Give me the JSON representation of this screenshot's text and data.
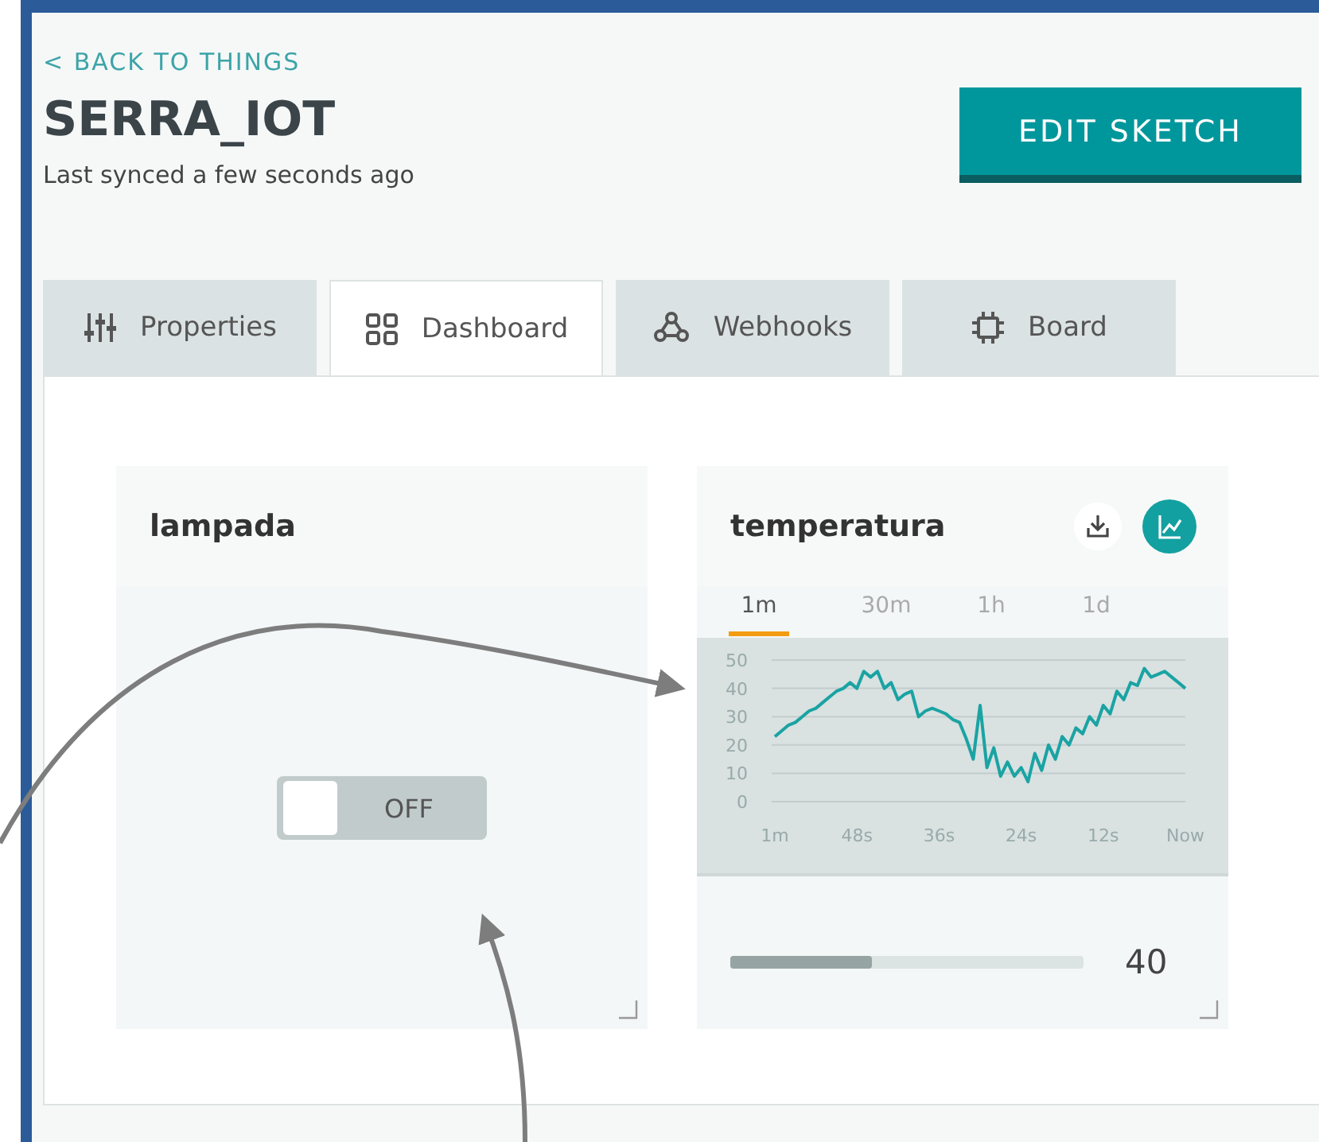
{
  "back_link": "< BACK TO THINGS",
  "title": "SERRA_IOT",
  "sync_status": "Last synced a few seconds ago",
  "edit_button": "EDIT SKETCH",
  "tabs": [
    {
      "label": "Properties",
      "kind": "sliders",
      "selected": false
    },
    {
      "label": "Dashboard",
      "kind": "grid",
      "selected": true
    },
    {
      "label": "Webhooks",
      "kind": "webhook",
      "selected": false
    },
    {
      "label": "Board",
      "kind": "chip",
      "selected": false
    }
  ],
  "widgets": [
    {
      "kind": "switch",
      "title": "lampada",
      "on": false,
      "state_label": "OFF"
    },
    {
      "kind": "chart",
      "title": "temperatura",
      "ranges": [
        {
          "label": "1m",
          "selected": true
        },
        {
          "label": "30m",
          "selected": false
        },
        {
          "label": "1h",
          "selected": false
        },
        {
          "label": "1d",
          "selected": false
        }
      ],
      "chart_data": {
        "type": "line",
        "grid": true,
        "categories": [
          "1m",
          null,
          null,
          null,
          null,
          null,
          null,
          null,
          null,
          null,
          null,
          null,
          "48s",
          null,
          null,
          null,
          null,
          null,
          null,
          null,
          null,
          null,
          null,
          null,
          "36s",
          null,
          null,
          null,
          null,
          null,
          null,
          null,
          null,
          null,
          null,
          null,
          "24s",
          null,
          null,
          null,
          null,
          null,
          null,
          null,
          null,
          null,
          null,
          null,
          "12s",
          null,
          null,
          null,
          null,
          null,
          null,
          null,
          null,
          null,
          null,
          null,
          "Now"
        ],
        "series": [
          {
            "color": "#1aa3a3",
            "values": [
              23,
              25,
              27,
              28,
              30,
              32,
              33,
              35,
              37,
              39,
              40,
              42,
              40,
              46,
              44,
              46,
              40,
              42,
              36,
              38,
              39,
              30,
              32,
              33,
              32,
              31,
              29,
              28,
              22,
              15,
              34,
              12,
              19,
              9,
              14,
              9,
              12,
              7,
              17,
              11,
              20,
              15,
              23,
              20,
              26,
              24,
              30,
              27,
              34,
              31,
              39,
              36,
              42,
              41,
              47,
              44,
              45,
              46,
              44,
              42,
              40
            ]
          }
        ],
        "ylim": [
          0,
          50
        ],
        "yticks": [
          0,
          10,
          20,
          30,
          40,
          50
        ]
      },
      "level": 0.4,
      "reading": "40"
    }
  ]
}
